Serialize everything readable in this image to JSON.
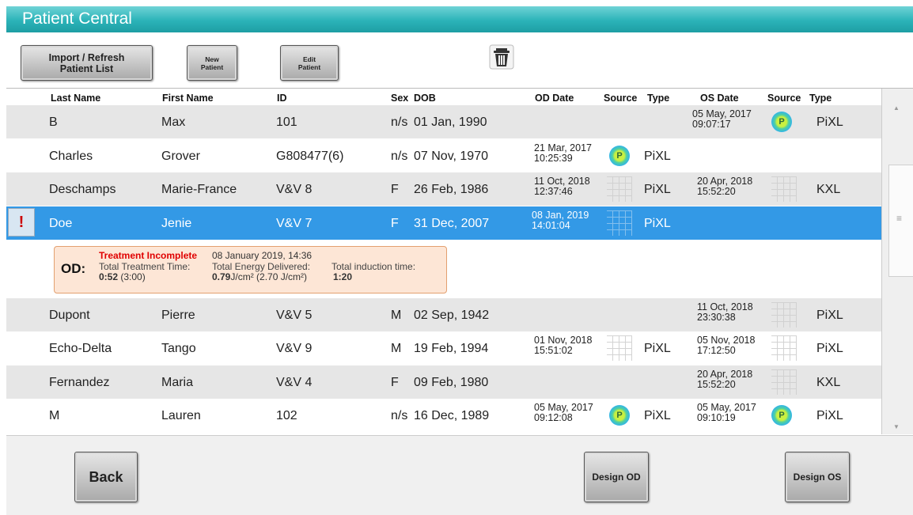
{
  "app": {
    "title": "Patient Central"
  },
  "toolbar": {
    "import_label": "Import / Refresh\nPatient List",
    "new_label": "New\nPatient",
    "edit_label": "Edit\nPatient",
    "trash_icon": "trash-icon"
  },
  "columns": {
    "last": "Last Name",
    "first": "First Name",
    "id": "ID",
    "sex": "Sex",
    "dob": "DOB",
    "od_date": "OD Date",
    "od_source": "Source",
    "od_type": "Type",
    "os_date": "OS Date",
    "os_source": "Source",
    "os_type": "Type"
  },
  "rows": [
    {
      "last": "B",
      "first": "Max",
      "id": "101",
      "sex": "n/s",
      "dob": "01 Jan, 1990",
      "od_date": "",
      "od_time": "",
      "od_type": "",
      "os_date": "05 May, 2017",
      "os_time": "09:07:17",
      "os_type": "PiXL"
    },
    {
      "last": "Charles",
      "first": "Grover",
      "id": "G808477(6)",
      "sex": "n/s",
      "dob": "07 Nov, 1970",
      "od_date": "21 Mar, 2017",
      "od_time": "10:25:39",
      "od_type": "PiXL",
      "os_date": "",
      "os_time": "",
      "os_type": ""
    },
    {
      "last": "Deschamps",
      "first": "Marie-France",
      "id": "V&V 8",
      "sex": "F",
      "dob": "26 Feb, 1986",
      "od_date": "11 Oct, 2018",
      "od_time": "12:37:46",
      "od_type": "PiXL",
      "os_date": "20 Apr, 2018",
      "os_time": "15:52:20",
      "os_type": "KXL"
    },
    {
      "last": "Doe",
      "first": "Jenie",
      "id": "V&V 7",
      "sex": "F",
      "dob": "31 Dec, 2007",
      "od_date": "08 Jan, 2019",
      "od_time": "14:01:04",
      "od_type": "PiXL",
      "os_date": "",
      "os_time": "",
      "os_type": ""
    },
    {
      "last": "Dupont",
      "first": "Pierre",
      "id": "V&V 5",
      "sex": "M",
      "dob": "02 Sep, 1942",
      "od_date": "",
      "od_time": "",
      "od_type": "",
      "os_date": "11 Oct, 2018",
      "os_time": "23:30:38",
      "os_type": "PiXL"
    },
    {
      "last": "Echo-Delta",
      "first": "Tango",
      "id": "V&V 9",
      "sex": "M",
      "dob": "19 Feb, 1994",
      "od_date": "01 Nov, 2018",
      "od_time": "15:51:02",
      "od_type": "PiXL",
      "os_date": "05 Nov, 2018",
      "os_time": "17:12:50",
      "os_type": "PiXL"
    },
    {
      "last": "Fernandez",
      "first": "Maria",
      "id": "V&V 4",
      "sex": "F",
      "dob": "09 Feb, 1980",
      "od_date": "",
      "od_time": "",
      "od_type": "",
      "os_date": "20 Apr, 2018",
      "os_time": "15:52:20",
      "os_type": "KXL"
    },
    {
      "last": "M",
      "first": "Lauren",
      "id": "102",
      "sex": "n/s",
      "dob": "16 Dec, 1989",
      "od_date": "05 May, 2017",
      "od_time": "09:12:08",
      "od_type": "PiXL",
      "os_date": "05 May, 2017",
      "os_time": "09:10:19",
      "os_type": "PiXL"
    }
  ],
  "badge": {
    "p_letter": "P",
    "alert_mark": "!"
  },
  "detail": {
    "eye": "OD:",
    "status": "Treatment Incomplete",
    "date": "08 January 2019, 14:36",
    "treat_label": "Total Treatment Time:",
    "treat_value": "0:52",
    "treat_planned": "(3:00)",
    "energy_label": "Total Energy Delivered:",
    "energy_value": "0.79",
    "energy_unit": "J/cm²",
    "energy_planned": "(2.70 J/cm²)",
    "induction_label": "Total induction time:",
    "induction_value": "1:20"
  },
  "scrollbar": {
    "grip": "≡"
  },
  "footer": {
    "back_label": "Back",
    "design_od_label": "Design OD",
    "design_os_label": "Design OS"
  },
  "colors": {
    "title_teal": "#2bb3b8",
    "selected_blue": "#3399e6",
    "status_red": "#e00000",
    "card_bg": "#fde6d6"
  }
}
